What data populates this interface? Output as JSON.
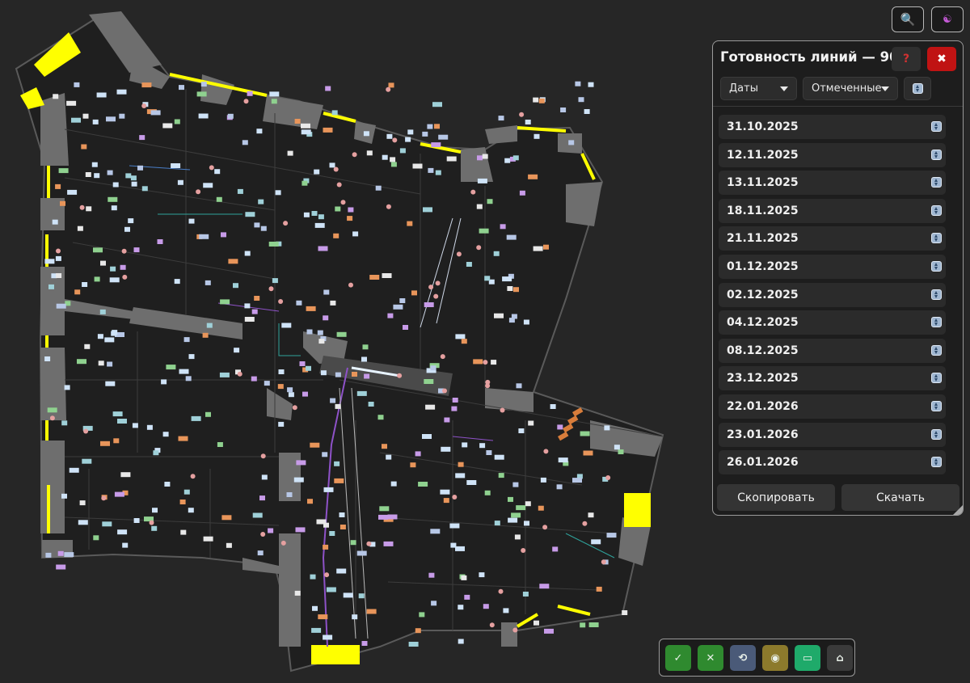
{
  "topbar": {
    "search_icon": "magnifier-icon",
    "layers_icon": "layers-icon"
  },
  "panel": {
    "title": "Готовность линий — 90%",
    "help_label": "?",
    "close_label": "✖",
    "dates_dropdown": "Даты",
    "filter_dropdown": "Отмеченные",
    "dates": [
      "31.10.2025",
      "12.11.2025",
      "13.11.2025",
      "18.11.2025",
      "21.11.2025",
      "01.12.2025",
      "02.12.2025",
      "04.12.2025",
      "08.12.2025",
      "23.12.2025",
      "22.01.2026",
      "23.01.2026",
      "26.01.2026"
    ],
    "copy_label": "Скопировать",
    "download_label": "Скачать"
  },
  "toolbar": {
    "tools": [
      {
        "icon": "check-icon",
        "glyph": "✓",
        "color": "#2f8a2f"
      },
      {
        "icon": "cross-icon",
        "glyph": "✕",
        "color": "#2f8a2f"
      },
      {
        "icon": "refresh-icon",
        "glyph": "⟲",
        "color": "#4a5a78"
      },
      {
        "icon": "cable-icon",
        "glyph": "◉",
        "color": "#8c7a2c"
      },
      {
        "icon": "box-icon",
        "glyph": "▭",
        "color": "#1faa6a"
      },
      {
        "icon": "house-icon",
        "glyph": "⌂",
        "color": "#3a3a3a"
      }
    ]
  },
  "colors": {
    "background": "#262626",
    "floor": "#1e1e1e",
    "walls": "#6f6f6f",
    "highlight": "#ffff00"
  }
}
